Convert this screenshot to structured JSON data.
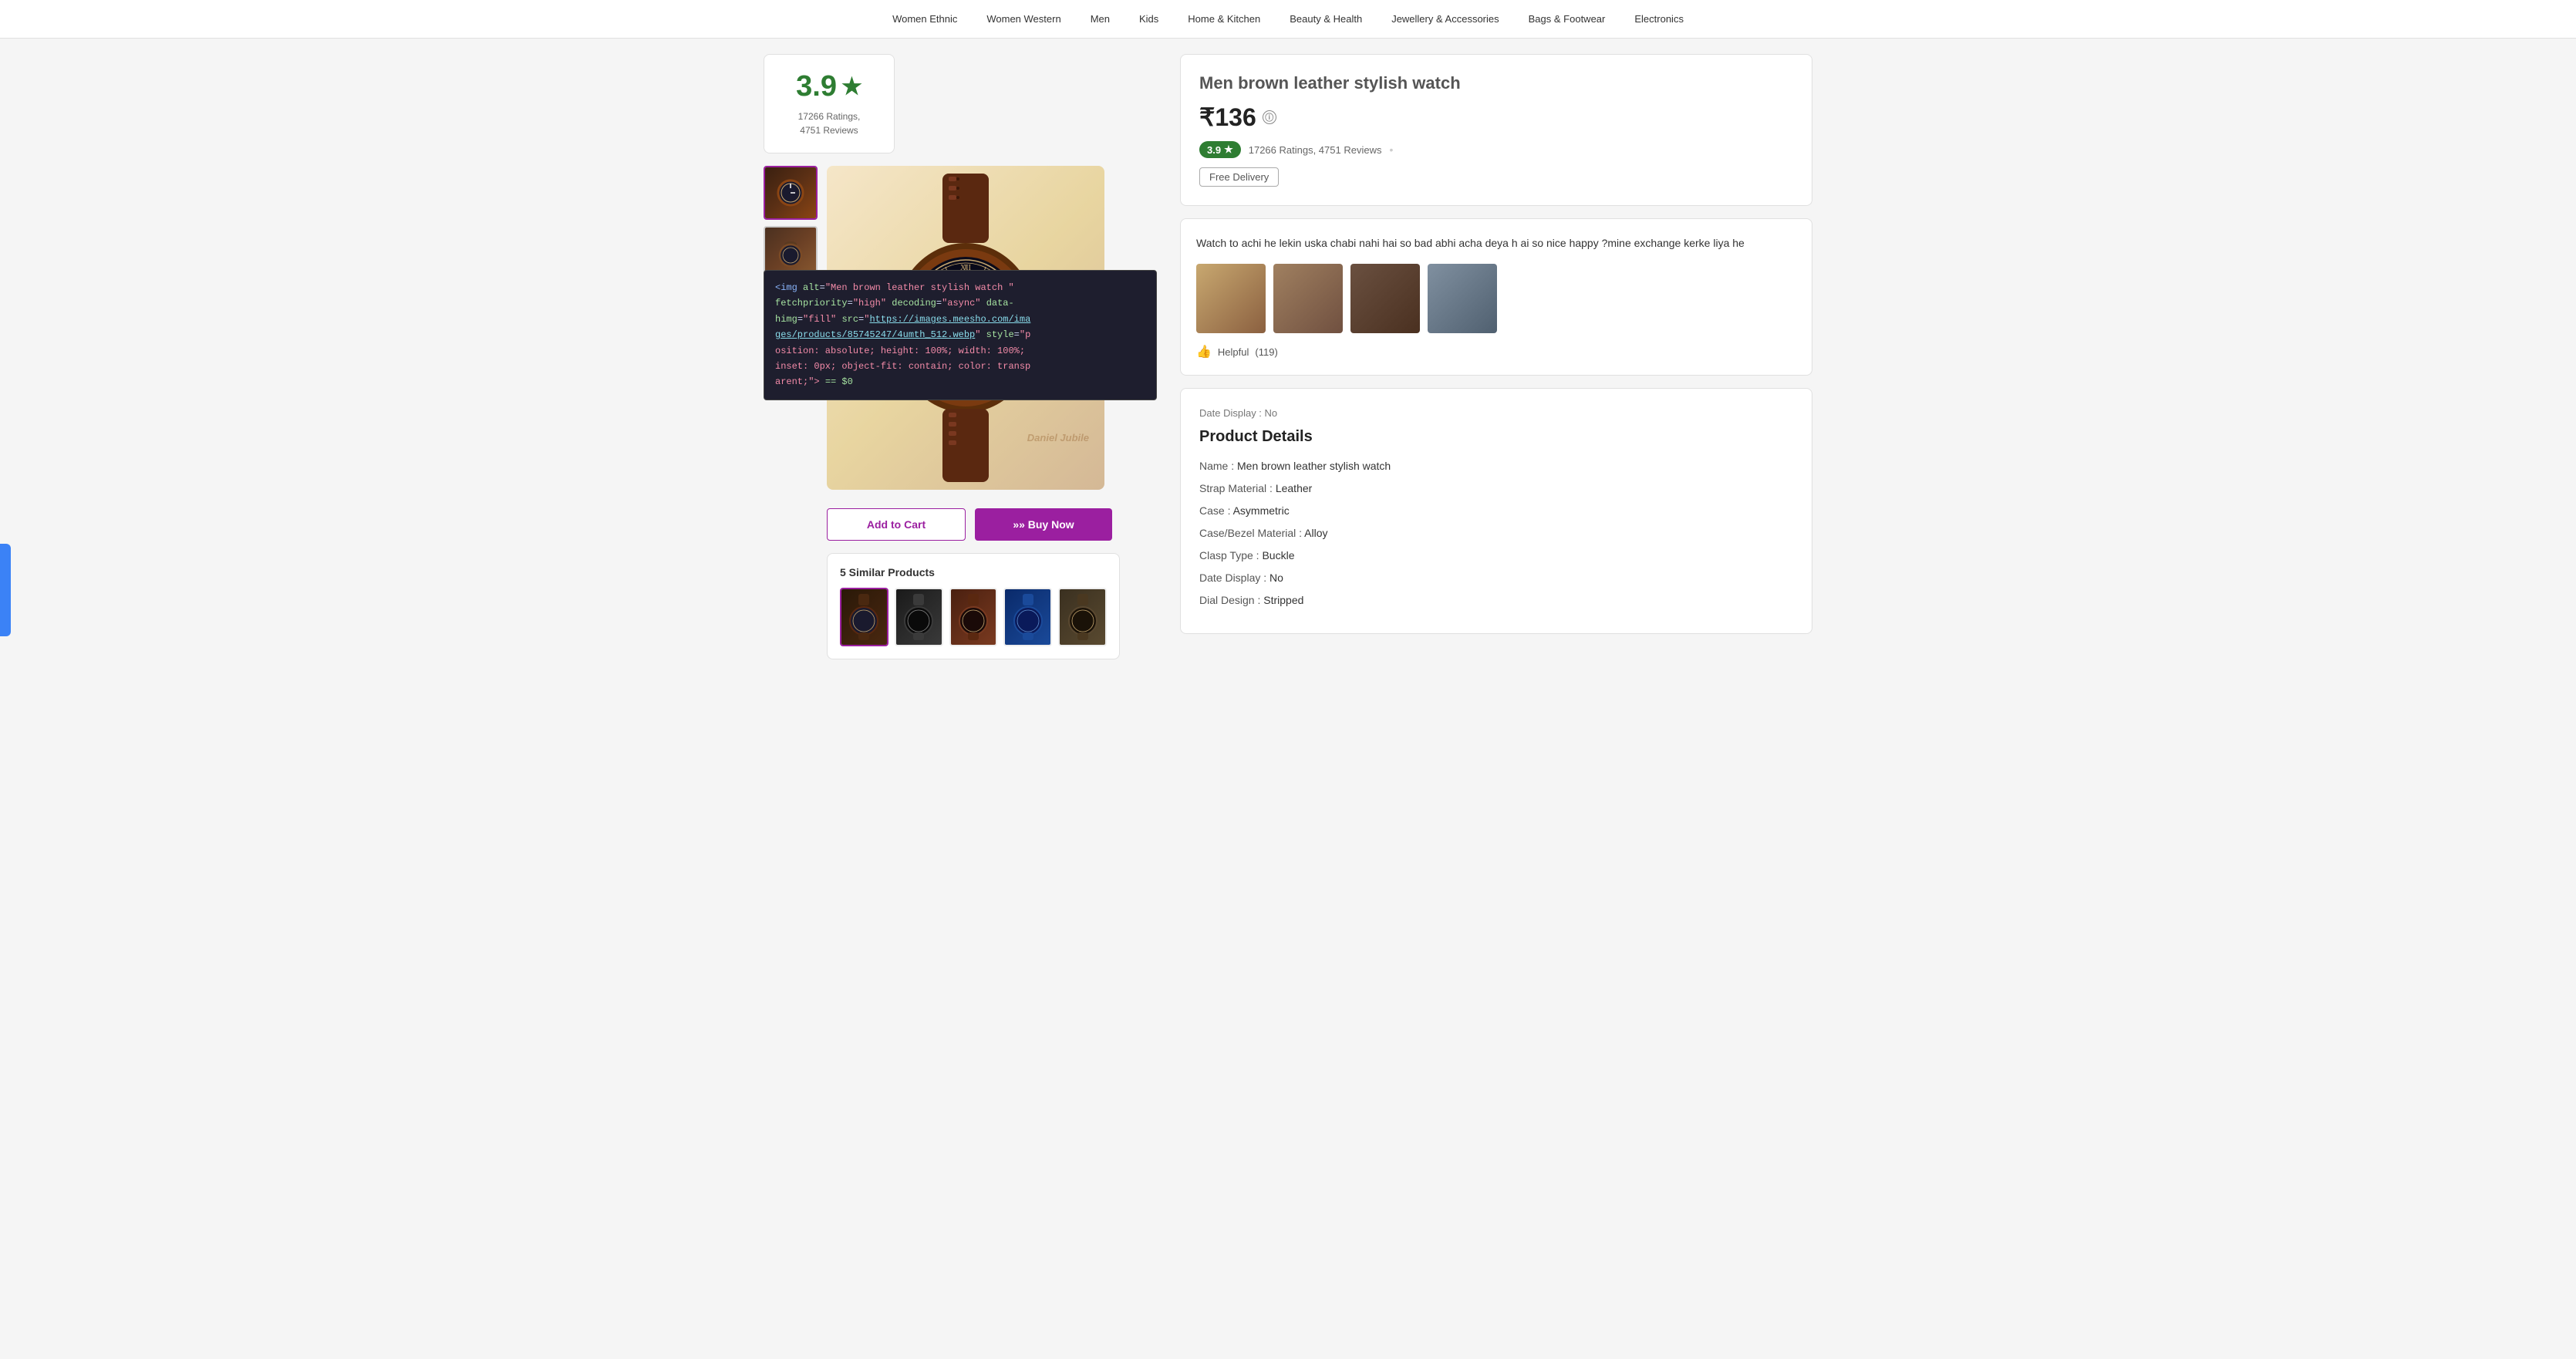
{
  "navbar": {
    "items": [
      {
        "label": "Women Ethnic"
      },
      {
        "label": "Women Western"
      },
      {
        "label": "Men"
      },
      {
        "label": "Kids"
      },
      {
        "label": "Home & Kitchen"
      },
      {
        "label": "Beauty & Health"
      },
      {
        "label": "Jewellery & Accessories"
      },
      {
        "label": "Bags & Footwear"
      },
      {
        "label": "Electronics"
      }
    ]
  },
  "rating_box": {
    "score": "3.9",
    "star": "★",
    "counts": "17266 Ratings,",
    "reviews": "4751 Reviews"
  },
  "product": {
    "title": "Men brown leather stylish watch",
    "price": "₹136",
    "info_icon": "ⓘ",
    "rating_badge": "3.9",
    "rating_star": "★",
    "rating_counts": "17266 Ratings, 4751 Reviews",
    "dot": "•",
    "free_delivery": "Free Delivery"
  },
  "review": {
    "text": "Watch to achi he lekin uska chabi nahi hai so bad abhi acha deya h ai so nice happy ?mine exchange kerke liya he",
    "helpful_label": "Helpful",
    "helpful_count": "(119)"
  },
  "product_details": {
    "title": "Product Details",
    "date_display_note": "Date Display : No",
    "rows": [
      {
        "label": "Name : ",
        "value": "Men brown leather stylish watch"
      },
      {
        "label": "Strap Material : ",
        "value": "Leather"
      },
      {
        "label": "Case : ",
        "value": "Asymmetric"
      },
      {
        "label": "Case/Bezel Material : ",
        "value": "Alloy"
      },
      {
        "label": "Clasp Type : ",
        "value": "Buckle"
      },
      {
        "label": "Date Display : ",
        "value": "No"
      },
      {
        "label": "Dial Design : ",
        "value": "Stripped"
      }
    ]
  },
  "devtools": {
    "line1": "<img alt=\"Men brown leather stylish watch \"",
    "line2": "fetchpriority=\"high\" decoding=\"async\" data-",
    "line3": "himg=\"fill\" src=\"https://images.meesho.com/ima",
    "line4": "ges/products/85745247/4umth_512.webp\" style=\"p",
    "line5": "osition: absolute; height: 100%; width: 100%;",
    "line6": "inset: 0px; object-fit: contain; color: transp",
    "line7": "arent;\"> == $0"
  },
  "buttons": {
    "add_to_cart": "Add to Cart",
    "buy_now": "»» Buy Now"
  },
  "similar": {
    "title": "5 Similar Products"
  }
}
